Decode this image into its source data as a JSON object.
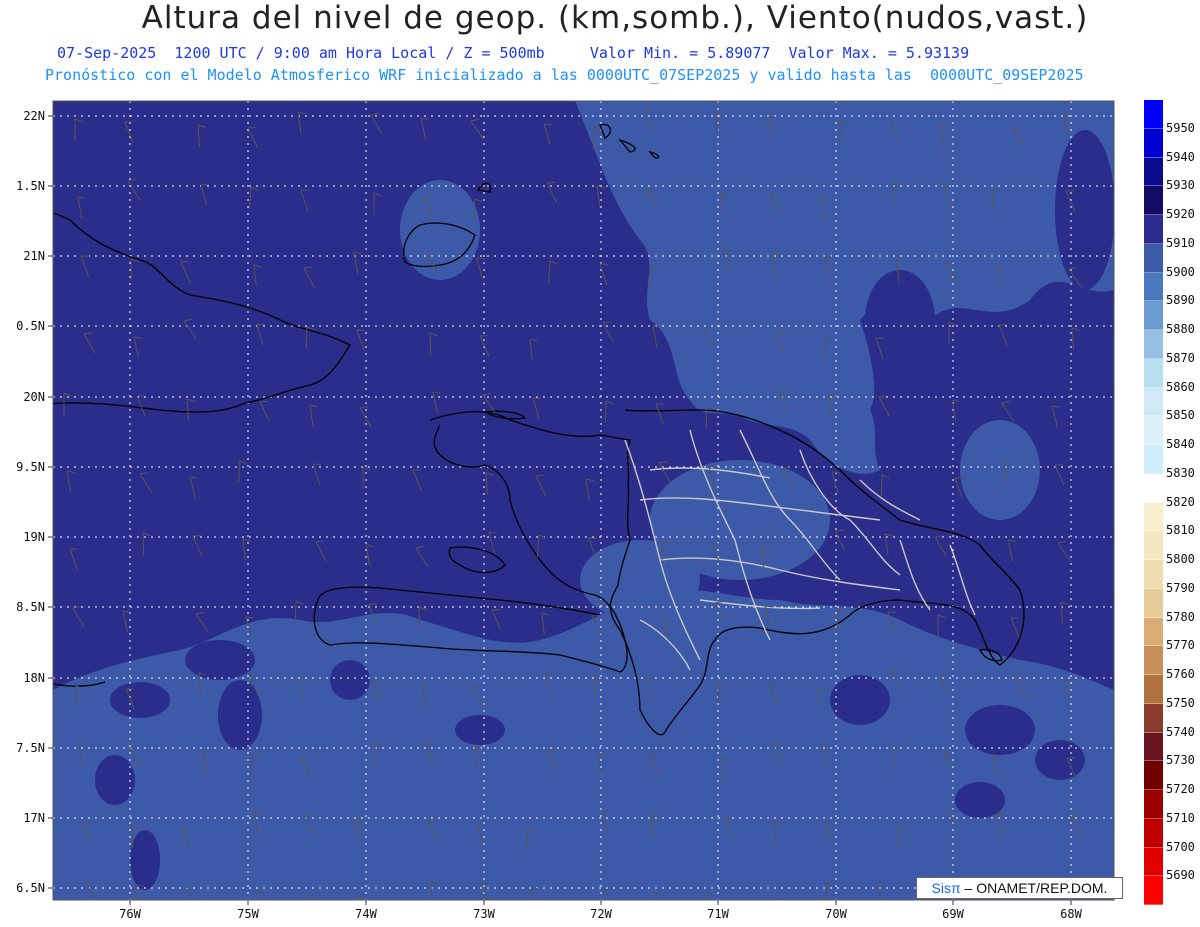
{
  "title": "Altura del nivel de geop. (km,somb.), Viento(nudos,vast.)",
  "subtitle": "07-Sep-2025  1200 UTC / 9:00 am Hora Local / Z = 500mb     Valor Min. = 5.89077  Valor Max. = 5.93139",
  "model_info": "Pronóstico con el Modelo Atmosferico WRF inicializado a las 0000UTC_07SEP2025 y valido hasta las  0000UTC_09SEP2025",
  "lat_labels": [
    "22N",
    "1.5N",
    "21N",
    "0.5N",
    "20N",
    "9.5N",
    "19N",
    "8.5N",
    "18N",
    "7.5N",
    "17N",
    "6.5N"
  ],
  "lon_labels": [
    "76W",
    "75W",
    "74W",
    "73W",
    "72W",
    "71W",
    "70W",
    "69W",
    "68W"
  ],
  "legend": {
    "levels": [
      "5950",
      "5940",
      "5930",
      "5920",
      "5910",
      "5900",
      "5890",
      "5880",
      "5870",
      "5860",
      "5850",
      "5840",
      "5830",
      "5820",
      "5810",
      "5800",
      "5790",
      "5780",
      "5770",
      "5760",
      "5750",
      "5740",
      "5730",
      "5720",
      "5710",
      "5700",
      "5690"
    ],
    "colors": [
      "#0000ff",
      "#0000d2",
      "#0a0a8c",
      "#140a66",
      "#2a2a8f",
      "#3c5aa8",
      "#4a78be",
      "#6a9bd0",
      "#95c0e2",
      "#b8dff0",
      "#cfeaf6",
      "#dcf0fa",
      "#cdeefa",
      "#ffffff",
      "#f8f0cc",
      "#f5e8c0",
      "#efdcb0",
      "#e8cc98",
      "#d8ac74",
      "#c89058",
      "#b07040",
      "#8a3a2a",
      "#6a1420",
      "#700000",
      "#9a0000",
      "#c00000",
      "#e00000",
      "#ff0000"
    ]
  },
  "credit": {
    "sis": "Sisπ",
    "org": "– ONAMET/REP.DOM."
  },
  "colors": {
    "field_high": "#2b2d8a",
    "field_low": "#3e5da8",
    "coast": "#000000",
    "borders": "#c8c8c8",
    "grid": "#ffffff",
    "barbs": "#555555"
  }
}
